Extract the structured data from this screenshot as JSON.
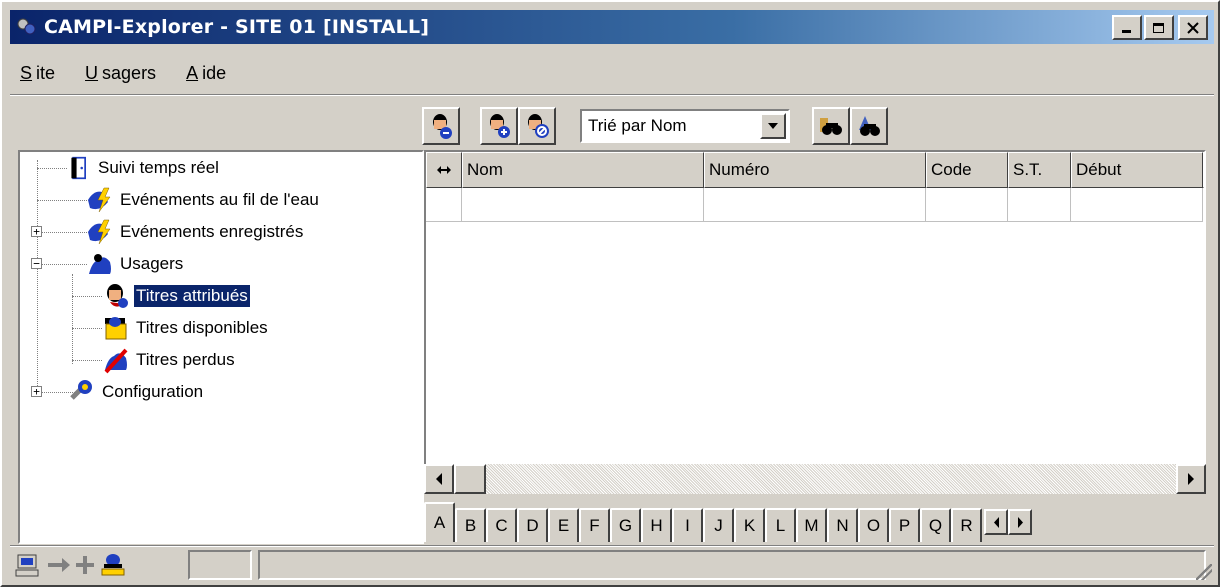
{
  "window": {
    "title": "CAMPI-Explorer - SITE 01 [INSTALL]",
    "controls": [
      "minimize",
      "maximize",
      "close"
    ]
  },
  "menu": {
    "site": "Site",
    "usagers": "Usagers",
    "aide": "Aide"
  },
  "toolbar": {
    "sort_value": "Trié par Nom",
    "buttons": [
      "user-view-icon",
      "user-add-icon",
      "user-block-icon",
      "search-filter-icon",
      "binoculars-icon"
    ]
  },
  "tree": {
    "items": [
      {
        "label": "Suivi temps réel",
        "icon": "door-icon"
      },
      {
        "label": "Evénements au fil de l'eau",
        "icon": "lightning-icon"
      },
      {
        "label": "Evénements enregistrés",
        "icon": "lightning-icon"
      },
      {
        "label": "Usagers",
        "icon": "users-icon"
      },
      {
        "label": "Titres attribués",
        "icon": "assigned-titles-icon"
      },
      {
        "label": "Titres disponibles",
        "icon": "available-titles-icon"
      },
      {
        "label": "Titres perdus",
        "icon": "lost-titles-icon"
      },
      {
        "label": "Configuration",
        "icon": "wrench-icon"
      }
    ]
  },
  "grid": {
    "columns": [
      "Nom",
      "Numéro",
      "Code",
      "S.T.",
      "Début"
    ]
  },
  "alphabet": [
    "A",
    "B",
    "C",
    "D",
    "E",
    "F",
    "G",
    "H",
    "I",
    "J",
    "K",
    "L",
    "M",
    "N",
    "O",
    "P",
    "Q",
    "R"
  ],
  "colors": {
    "title_start": "#0a246a",
    "title_end": "#a6caf0",
    "selection": "#0a246a",
    "face": "#d4d0c8"
  }
}
